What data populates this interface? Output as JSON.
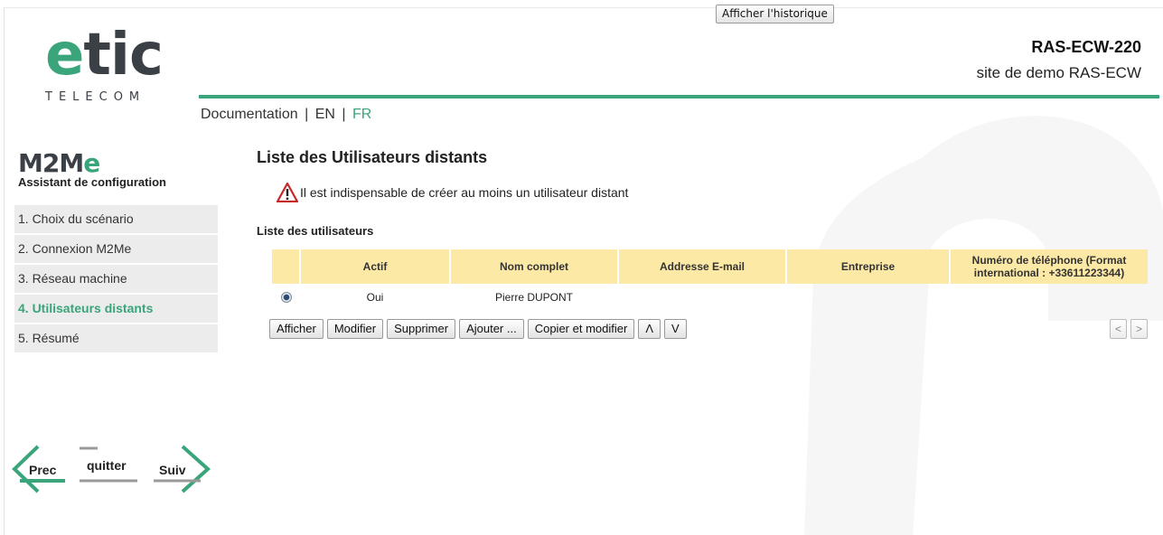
{
  "header": {
    "history_button": "Afficher l'historique",
    "logo_word_e": "e",
    "logo_word_tic": "tic",
    "logo_sub": "TELECOM",
    "device_name": "RAS-ECW-220",
    "site_name": "site de demo RAS-ECW"
  },
  "toplinks": {
    "documentation": "Documentation",
    "separator": "|",
    "en": "EN",
    "fr": "FR"
  },
  "sidebar": {
    "logo_m2m": "M2M",
    "logo_e": "e",
    "subtitle": "Assistant de configuration",
    "steps": [
      {
        "label": "1. Choix du scénario",
        "active": false
      },
      {
        "label": "2. Connexion M2Me",
        "active": false
      },
      {
        "label": "3. Réseau machine",
        "active": false
      },
      {
        "label": "4. Utilisateurs distants",
        "active": true
      },
      {
        "label": "5. Résumé",
        "active": false
      }
    ],
    "nav": {
      "prev": "Prec",
      "quit": "quitter",
      "next": "Suiv"
    }
  },
  "main": {
    "title": "Liste des Utilisateurs distants",
    "warning": "Il est indispensable de créer au moins un utilisateur distant",
    "list_title": "Liste des utilisateurs",
    "table": {
      "headers": [
        "",
        "Actif",
        "Nom complet",
        "Addresse E-mail",
        "Entreprise",
        "Numéro de téléphone (Format international : +33611223344)"
      ],
      "rows": [
        {
          "selected": true,
          "actif": "Oui",
          "nom": "Pierre DUPONT",
          "email": "",
          "entreprise": "",
          "telephone": ""
        }
      ]
    },
    "buttons": {
      "afficher": "Afficher",
      "modifier": "Modifier",
      "supprimer": "Supprimer",
      "ajouter": "Ajouter ...",
      "copier": "Copier et modifier",
      "up": "Λ",
      "down": "V"
    },
    "pager": {
      "prev": "<",
      "next": ">"
    }
  },
  "colors": {
    "brand_green": "#3aa57a",
    "brand_dark": "#3b4047",
    "table_header": "#fde9a6",
    "nav_item_bg": "#ececec",
    "warning_red": "#c62828"
  }
}
